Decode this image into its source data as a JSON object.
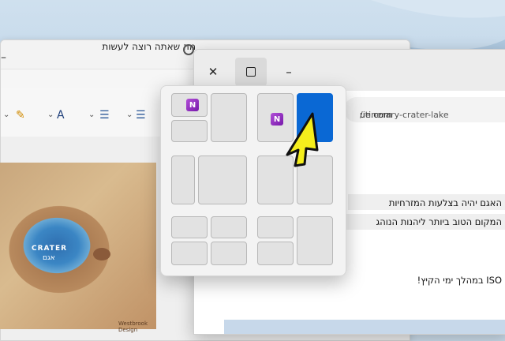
{
  "back_window": {
    "minimize_glyph": "–",
    "tell_me": "מה שאתה רוצה לעשות",
    "ribbon_icons": [
      "bullets-icon",
      "numbering-icon",
      "font-color-icon",
      "highlight-icon"
    ],
    "map": {
      "label_en": "CRATER",
      "label_he": "אגם",
      "footer": "Westbrook Design"
    }
  },
  "front_window": {
    "close_glyph": "✕",
    "minimize_glyph": "–",
    "address": {
      "host": "ue.com",
      "path": "/itinerary-crater-lake"
    },
    "lines": [
      "האגם יהיה בצלעות המזרחיות",
      "המקום הטוב ביותר ליהנות הנוהג",
      "ISO במהלך ימי הקיץ!"
    ]
  },
  "snap_layout": {
    "app_icon_letter": "N",
    "accent_color": "#0a68d4"
  }
}
